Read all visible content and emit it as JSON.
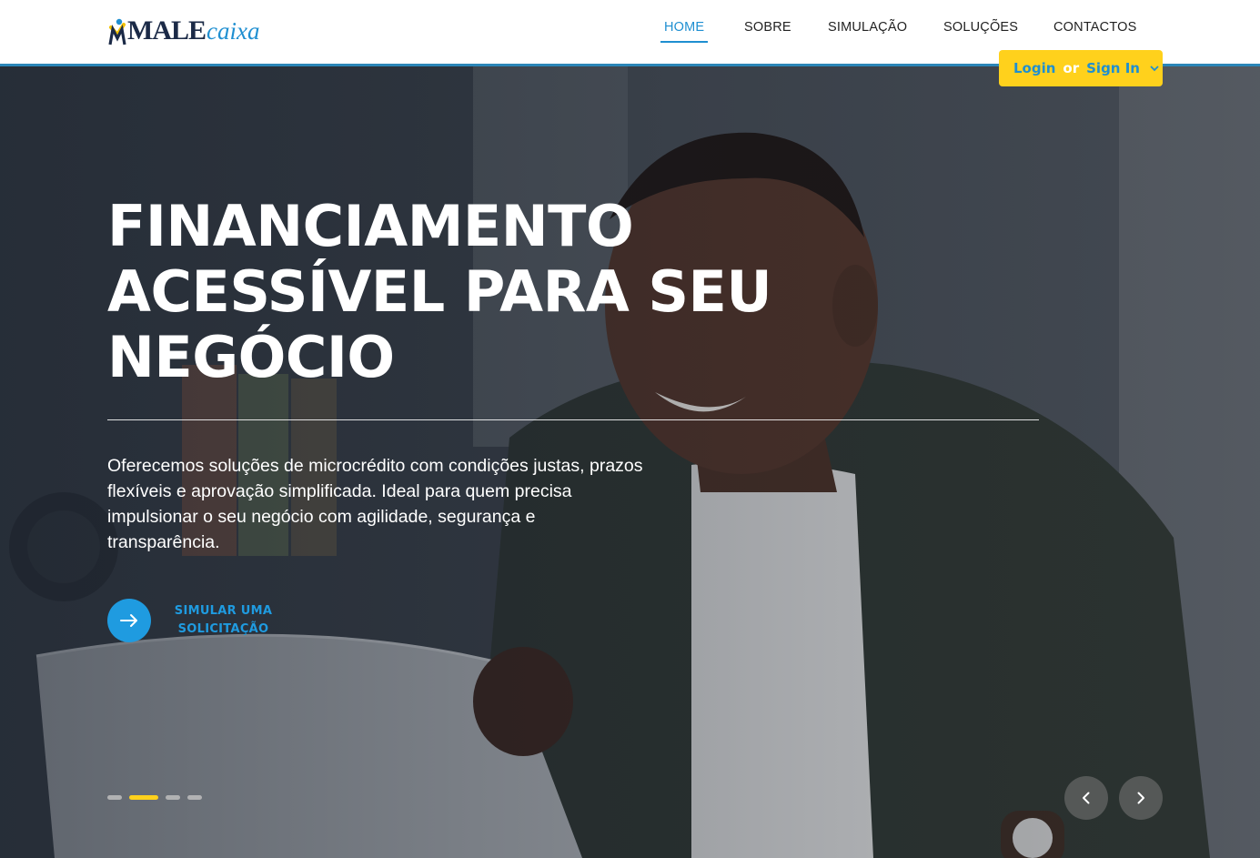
{
  "brand": {
    "logo_main": "MALE",
    "logo_sub": "caixa"
  },
  "nav": {
    "items": [
      {
        "label": "HOME",
        "active": true
      },
      {
        "label": "SOBRE",
        "active": false
      },
      {
        "label": "SIMULAÇÃO",
        "active": false
      },
      {
        "label": "SOLUÇÕES",
        "active": false
      },
      {
        "label": "CONTACTOS",
        "active": false
      }
    ]
  },
  "auth": {
    "login_label": "Login",
    "or_label": "or",
    "signin_label": "Sign In"
  },
  "hero": {
    "headline_lines": [
      "FINANCIAMENTO",
      "ACESSÍVEL PARA SEU",
      "NEGÓCIO"
    ],
    "description": "Oferecemos soluções de microcrédito com condições justas, prazos flexíveis e aprovação simplificada. Ideal para quem precisa impulsionar o seu negócio com agilidade, segurança e transparência.",
    "cta_label_line1": "SIMULAR UMA",
    "cta_label_line2": "SOLICITAÇÃO",
    "slides_count": 4,
    "active_slide": 2
  },
  "colors": {
    "accent_blue": "#1f8fd1",
    "accent_yellow": "#ffd11c",
    "header_line": "#2b86b8",
    "dark_text": "#222222"
  },
  "icons": {
    "cta": "arrow-right-icon",
    "prev": "chevron-left-icon",
    "next": "chevron-right-icon",
    "login_dropdown": "chevron-down-icon"
  }
}
